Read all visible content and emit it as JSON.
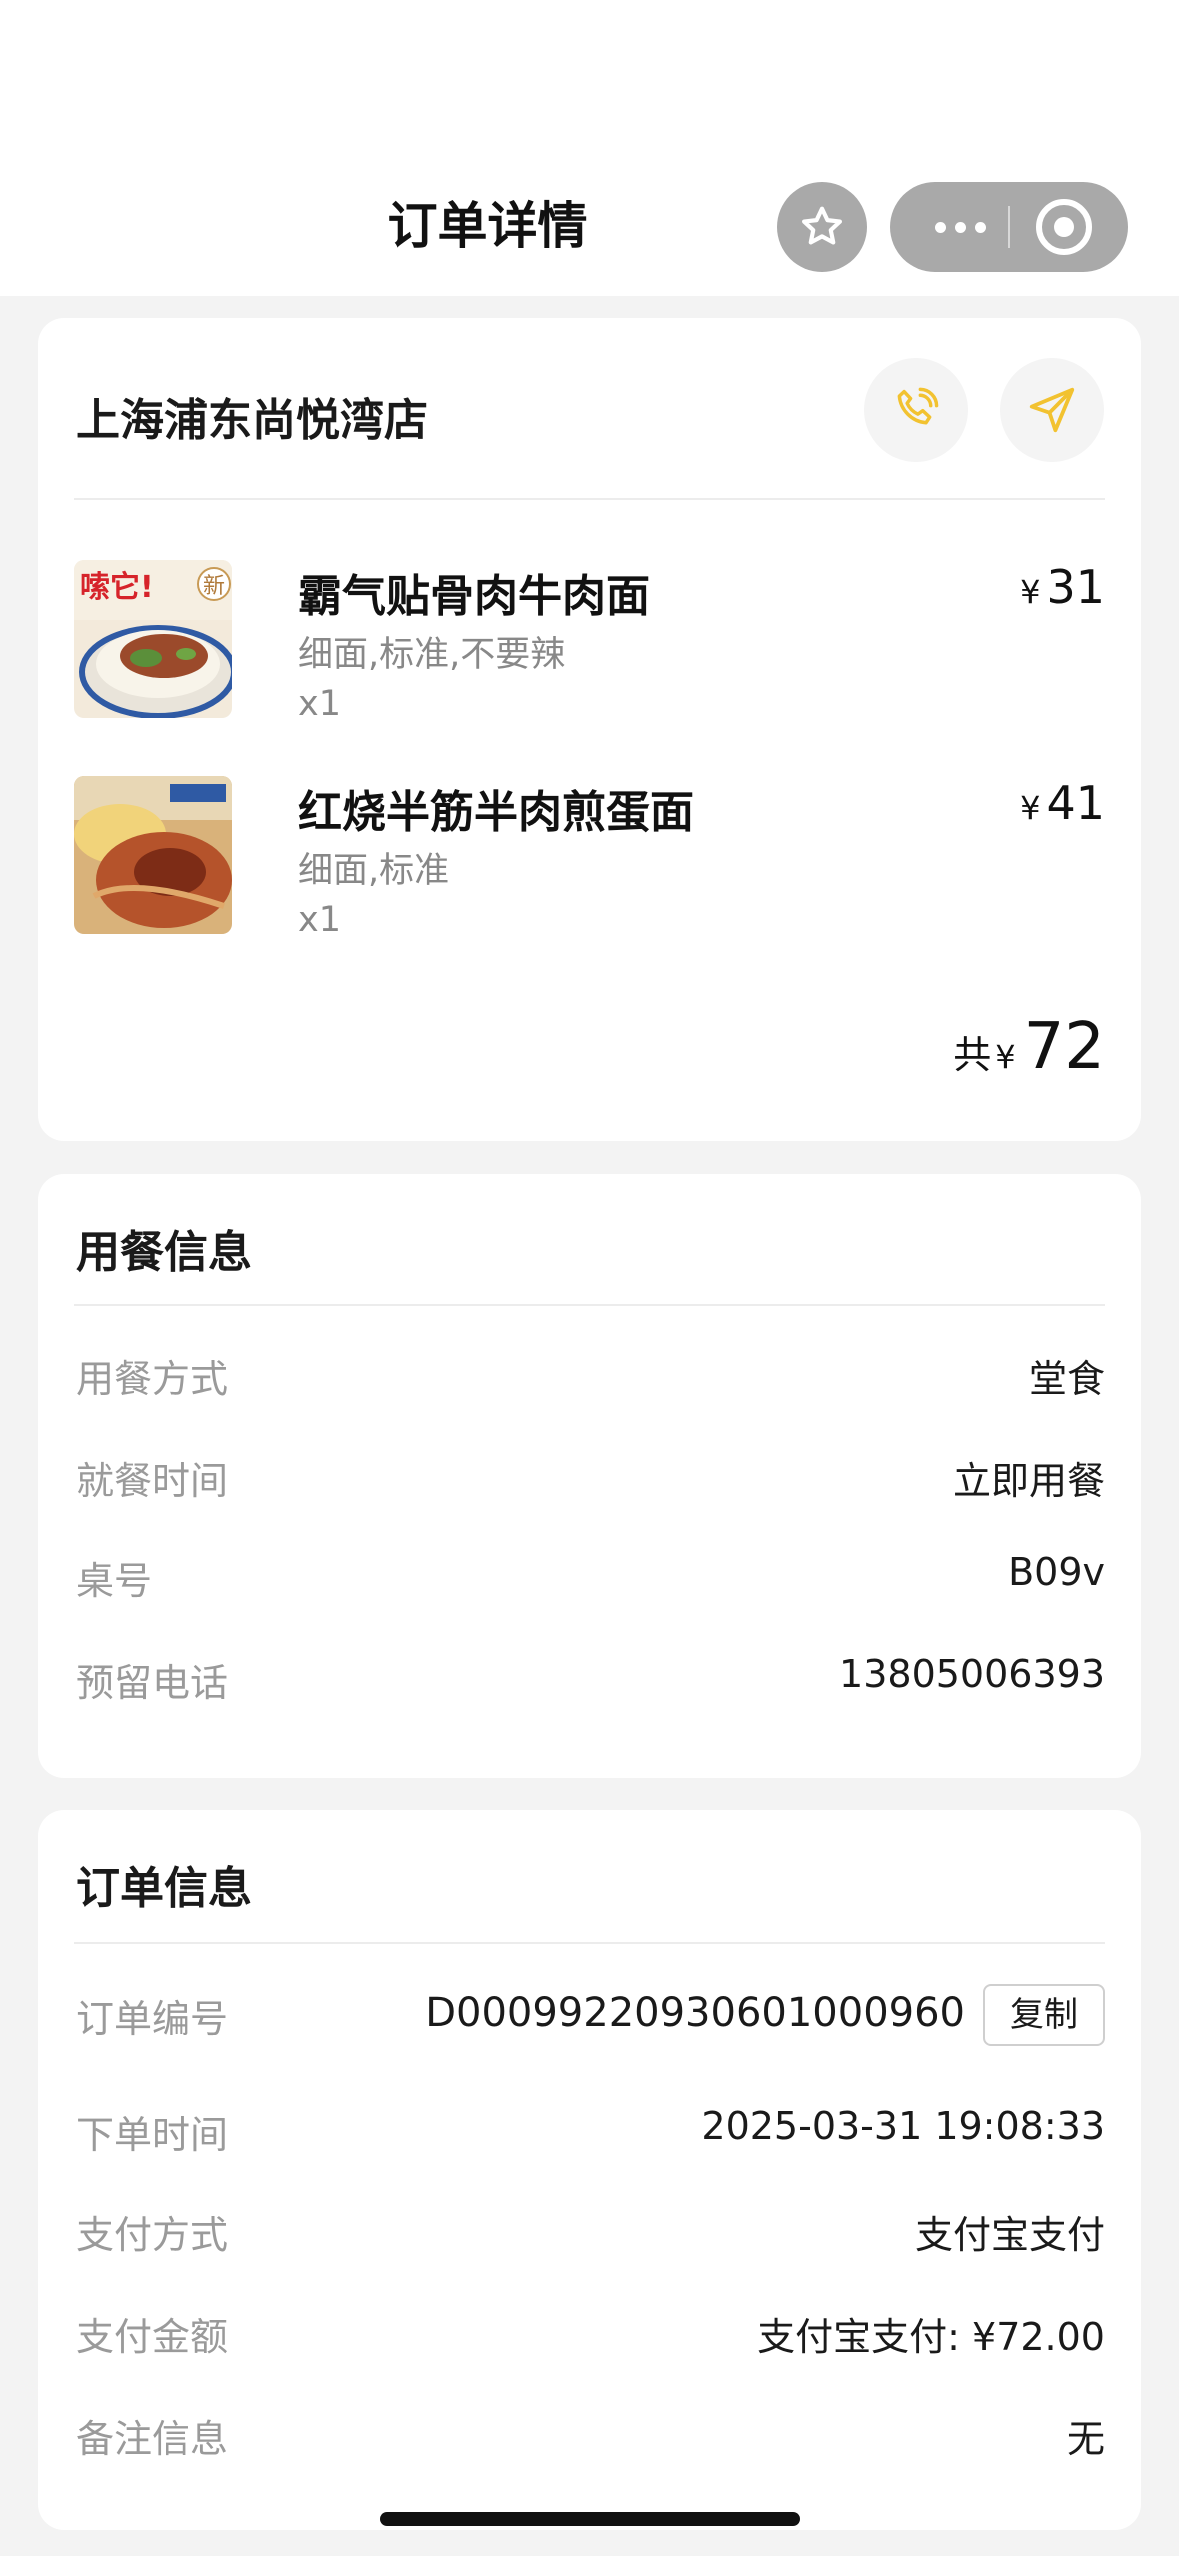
{
  "header": {
    "title": "订单详情",
    "favorite_icon": "star-icon",
    "more_icon": "more-dots-icon",
    "close_icon": "target-close-icon"
  },
  "store": {
    "name": "上海浦东尚悦湾店",
    "phone_icon": "phone-icon",
    "navigate_icon": "navigation-arrow-icon",
    "accent_color": "#f2c230"
  },
  "order_items": [
    {
      "name": "霸气贴骨肉牛肉面",
      "spec": "细面,标准,不要辣",
      "qty": "x1",
      "currency": "¥",
      "price": "31",
      "thumb_text": "嗦它!",
      "thumb_badge": "新"
    },
    {
      "name": "红烧半筋半肉煎蛋面",
      "spec": "细面,标准",
      "qty": "x1",
      "currency": "¥",
      "price": "41"
    }
  ],
  "total": {
    "prefix": "共",
    "currency": "¥",
    "value": "72"
  },
  "dining_info": {
    "title": "用餐信息",
    "rows": [
      {
        "label": "用餐方式",
        "value": "堂食"
      },
      {
        "label": "就餐时间",
        "value": "立即用餐"
      },
      {
        "label": "桌号",
        "value": "B09v"
      },
      {
        "label": "预留电话",
        "value": "13805006393"
      }
    ]
  },
  "order_info": {
    "title": "订单信息",
    "order_no_label": "订单编号",
    "order_no": "D000992209306010009​60",
    "copy_label": "复制",
    "rows": [
      {
        "label": "下单时间",
        "value": "2025-03-31 19:08:33"
      },
      {
        "label": "支付方式",
        "value": "支付宝支付"
      },
      {
        "label": "支付金额",
        "value": "支付宝支付: ¥72.00"
      },
      {
        "label": "备注信息",
        "value": "无"
      }
    ]
  }
}
